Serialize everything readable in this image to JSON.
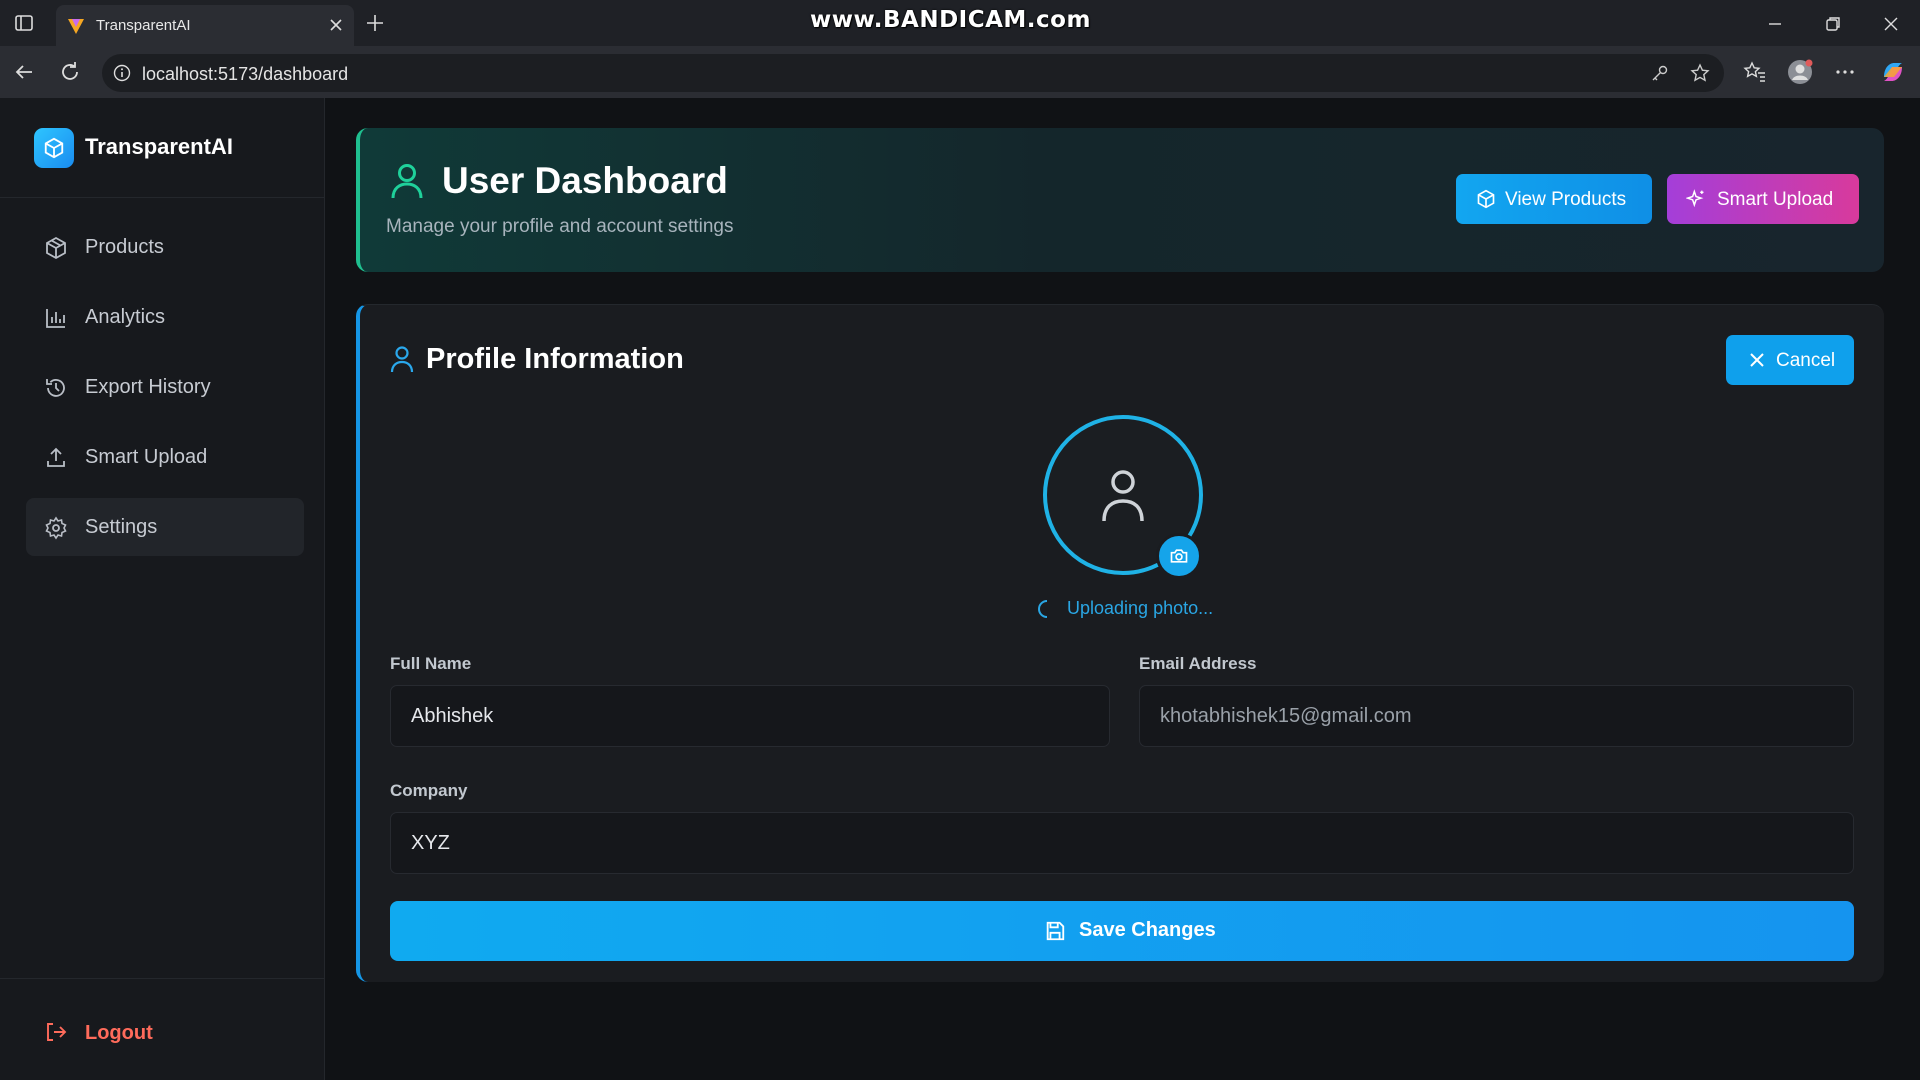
{
  "browser": {
    "tab_title": "TransparentAI",
    "watermark": "www.BANDICAM.com",
    "url": "localhost:5173/dashboard"
  },
  "sidebar": {
    "brand": "TransparentAI",
    "items": [
      {
        "label": "Products",
        "icon": "box-icon",
        "active": false
      },
      {
        "label": "Analytics",
        "icon": "bar-chart-icon",
        "active": false
      },
      {
        "label": "Export History",
        "icon": "history-icon",
        "active": false
      },
      {
        "label": "Smart Upload",
        "icon": "upload-icon",
        "active": false
      },
      {
        "label": "Settings",
        "icon": "gear-icon",
        "active": true
      }
    ],
    "logout_label": "Logout"
  },
  "header": {
    "title": "User Dashboard",
    "subtitle": "Manage your profile and account settings",
    "view_products_label": "View Products",
    "smart_upload_label": "Smart Upload"
  },
  "profile": {
    "title": "Profile Information",
    "cancel_label": "Cancel",
    "upload_status": "Uploading photo...",
    "full_name_label": "Full Name",
    "full_name_value": "Abhishek",
    "email_label": "Email Address",
    "email_value": "khotabhishek15@gmail.com",
    "company_label": "Company",
    "company_value": "XYZ",
    "save_label": "Save Changes"
  },
  "colors": {
    "accent_blue": "#12a6f0",
    "accent_green": "#1fbf8f",
    "accent_purple": "#a43ed9",
    "accent_pink": "#d83a9c",
    "logout_red": "#ff6b5b"
  }
}
